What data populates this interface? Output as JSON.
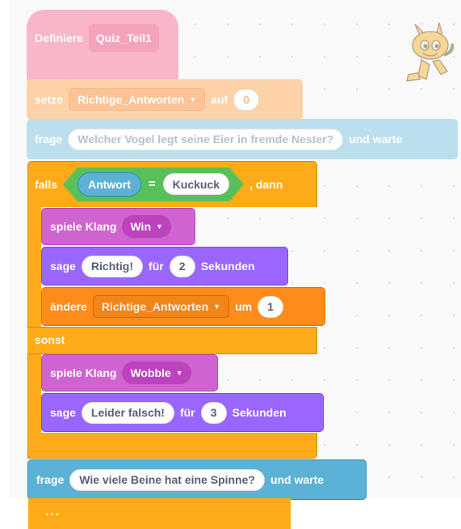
{
  "blocks": {
    "define": {
      "keyword": "Definiere",
      "name": "Quiz_Teil1"
    },
    "set_var": {
      "keyword": "setze",
      "variable": "Richtige_Antworten",
      "preposition": "auf",
      "value": "0"
    },
    "ask1": {
      "keyword": "frage",
      "question": "Welcher Vogel legt seine Eier in fremde Nester?",
      "suffix": "und warte"
    },
    "if_else": {
      "keyword": "falls",
      "condition": {
        "reporter": "Antwort",
        "operator": "=",
        "value": "Kuckuck"
      },
      "then": ", dann",
      "else_label": "sonst"
    },
    "play_win": {
      "keyword": "spiele Klang",
      "sound": "Win"
    },
    "say_right": {
      "keyword": "sage",
      "message": "Richtig!",
      "for": "für",
      "seconds": "2",
      "unit": "Sekunden"
    },
    "change_var": {
      "keyword": "ändere",
      "variable": "Richtige_Antworten",
      "by": "um",
      "value": "1"
    },
    "play_wobble": {
      "keyword": "spiele Klang",
      "sound": "Wobble"
    },
    "say_wrong": {
      "keyword": "sage",
      "message": "Leider falsch!",
      "for": "für",
      "seconds": "3",
      "unit": "Sekunden"
    },
    "ask2": {
      "keyword": "frage",
      "question": "Wie viele Beine hat eine Spinne?",
      "suffix": "und warte"
    },
    "more": "..."
  },
  "icons": {
    "dropdown": "caret-down-icon",
    "sprite": "scratch-cat-icon"
  },
  "colors": {
    "events_define": "#ff6680",
    "variables": "#ff8c1a",
    "sensing": "#5cb1d6",
    "control": "#ffab19",
    "operators": "#59c059",
    "sound": "#cf63cf",
    "looks": "#9966ff"
  }
}
